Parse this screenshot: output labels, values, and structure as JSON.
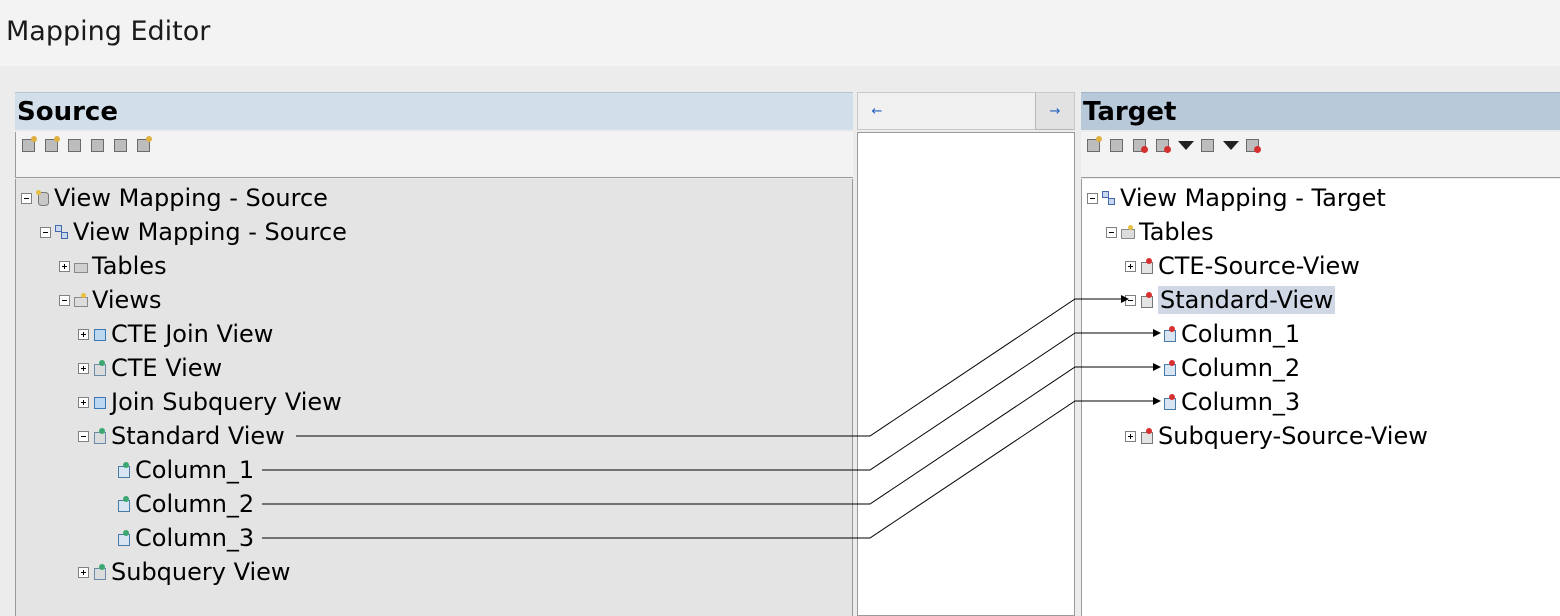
{
  "window": {
    "title": "Mapping Editor"
  },
  "source": {
    "header": "Source",
    "tree": {
      "root": "View Mapping - Source",
      "model": "View Mapping - Source",
      "tables": "Tables",
      "views": "Views",
      "view_items": [
        "CTE Join View",
        "CTE View",
        "Join Subquery View",
        "Standard View",
        "Subquery View"
      ],
      "columns": [
        "Column_1",
        "Column_2",
        "Column_3"
      ]
    }
  },
  "middle": {
    "left_arrow": "←",
    "right_arrow": "→"
  },
  "target": {
    "header": "Target",
    "tree": {
      "root": "View Mapping - Target",
      "tables": "Tables",
      "items": [
        "CTE-Source-View",
        "Standard-View",
        "Subquery-Source-View"
      ],
      "columns": [
        "Column_1",
        "Column_2",
        "Column_3"
      ]
    }
  },
  "colors": {
    "source_header": "#d2deea",
    "target_header": "#b8c9da",
    "selection": "#cfd8e4"
  }
}
